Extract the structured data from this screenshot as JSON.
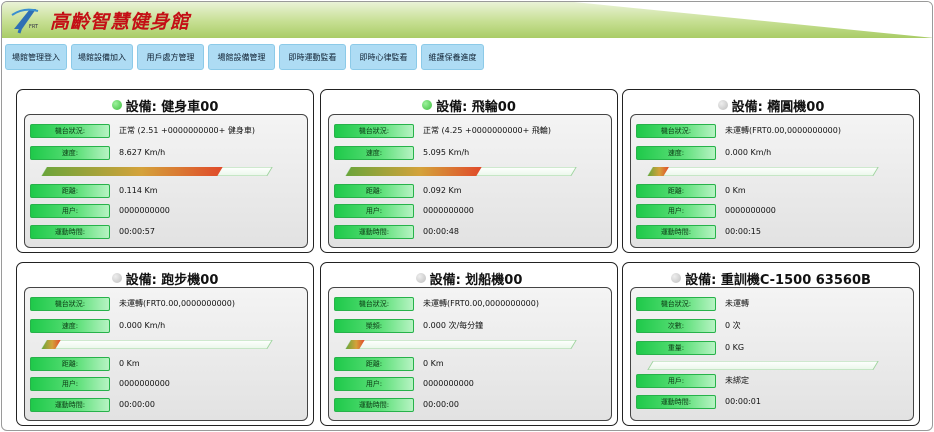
{
  "app": {
    "title": "高齡智慧健身館",
    "logo_text": "FRT"
  },
  "nav": {
    "tabs": [
      {
        "label": "場館管理登入"
      },
      {
        "label": "場館設備加入"
      },
      {
        "label": "用戶處方管理"
      },
      {
        "label": "場館設備管理"
      },
      {
        "label": "即時運動監看"
      },
      {
        "label": "即時心律監看"
      },
      {
        "label": "維護保養進度"
      }
    ]
  },
  "colors": {
    "accent_red": "#c40f16",
    "label_green": "#1fc94a",
    "tab_blue": "#aedcf4",
    "status_on": "#3cbc3c",
    "status_off": "#bdbdbd"
  },
  "devices": [
    {
      "title": "設備: 健身車00",
      "online": true,
      "progress": 0.78,
      "rows": [
        {
          "label": "機台狀況:",
          "value": "正常 (2.51 +0000000000+ 健身車)"
        },
        {
          "label": "速度:",
          "value": "8.627 Km/h"
        },
        {
          "label": "距離:",
          "value": "0.114 Km"
        },
        {
          "label": "用户:",
          "value": "0000000000"
        },
        {
          "label": "運動時間:",
          "value": "00:00:57"
        }
      ]
    },
    {
      "title": "設備: 飛輪00",
      "online": true,
      "progress": 0.58,
      "rows": [
        {
          "label": "機台狀況:",
          "value": "正常 (4.25 +0000000000+ 飛輪)"
        },
        {
          "label": "速度:",
          "value": "5.095 Km/h"
        },
        {
          "label": "距離:",
          "value": "0.092 Km"
        },
        {
          "label": "用户:",
          "value": "0000000000"
        },
        {
          "label": "運動時間:",
          "value": "00:00:48"
        }
      ]
    },
    {
      "title": "設備: 橢圓機00",
      "online": false,
      "progress": 0.07,
      "rows": [
        {
          "label": "機台狀況:",
          "value": "未運轉(FRT0.00,0000000000)"
        },
        {
          "label": "速度:",
          "value": "0.000 Km/h"
        },
        {
          "label": "距離:",
          "value": "0 Km"
        },
        {
          "label": "用户:",
          "value": "0000000000"
        },
        {
          "label": "運動時間:",
          "value": "00:00:15"
        }
      ]
    },
    {
      "title": "設備: 跑步機00",
      "online": false,
      "progress": 0.06,
      "rows": [
        {
          "label": "機台狀況:",
          "value": "未運轉(FRT0.00,0000000000)"
        },
        {
          "label": "速度:",
          "value": "0.000 Km/h"
        },
        {
          "label": "距離:",
          "value": "0 Km"
        },
        {
          "label": "用户:",
          "value": "0000000000"
        },
        {
          "label": "運動時間:",
          "value": "00:00:00"
        }
      ]
    },
    {
      "title": "設備: 划船機00",
      "online": false,
      "progress": 0.06,
      "rows": [
        {
          "label": "機台狀況:",
          "value": "未運轉(FRT0.00,0000000000)"
        },
        {
          "label": "槳頻:",
          "value": "0.000 次/每分鐘"
        },
        {
          "label": "距離:",
          "value": "0 Km"
        },
        {
          "label": "用户:",
          "value": "0000000000"
        },
        {
          "label": "運動時間:",
          "value": "00:00:00"
        }
      ]
    },
    {
      "title": "設備: 重訓機C-1500 63560B",
      "online": false,
      "progress": 0.0,
      "rows": [
        {
          "label": "機台狀況:",
          "value": "未運轉"
        },
        {
          "label": "次數:",
          "value": "0 次"
        },
        {
          "label": "重量:",
          "value": "0 KG"
        },
        {
          "label": "用戶:",
          "value": "未綁定"
        },
        {
          "label": "運動時間:",
          "value": "00:00:01"
        }
      ]
    }
  ]
}
